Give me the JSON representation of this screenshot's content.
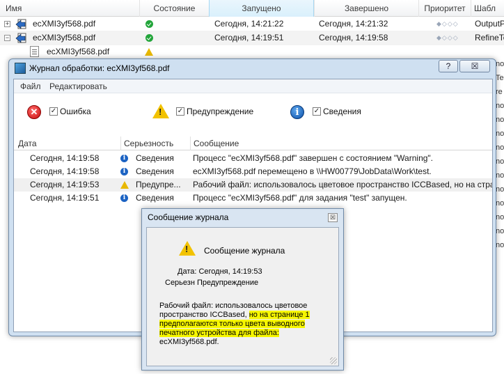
{
  "job_list": {
    "columns": [
      "Имя",
      "Состояние",
      "Запущено",
      "Завершено",
      "Приоритет",
      "Шабл"
    ],
    "rows": [
      {
        "name": "ecXMI3yf568.pdf",
        "started": "Сегодня, 14:21:22",
        "finished": "Сегодня, 14:21:32",
        "priority_dots": "◆◇◇◇",
        "template": "OutputP",
        "expander": "+"
      },
      {
        "name": "ecXMI3yf568.pdf",
        "started": "Сегодня, 14:19:51",
        "finished": "Сегодня, 14:19:58",
        "priority_dots": "◆◇◇◇",
        "template": "RefineTo",
        "expander": "−"
      },
      {
        "name": "ecXMI3yf568.pdf"
      }
    ],
    "right_edge_fragments": [
      "no",
      "Te",
      "re",
      "no",
      "no",
      "no",
      "no",
      "no",
      "no",
      "no",
      "no",
      "no",
      "no",
      "no"
    ]
  },
  "log_window": {
    "title": "Журнал обработки:  ecXMI3yf568.pdf",
    "help_button": "?",
    "close_button": "☒",
    "menu": [
      "Файл",
      "Редактировать"
    ],
    "filters": {
      "error": "Ошибка",
      "warning": "Предупреждение",
      "info": "Сведения",
      "check_mark": "✓"
    },
    "columns": [
      "Дата",
      "Серьезность",
      "Сообщение"
    ],
    "rows": [
      {
        "date": "Сегодня, 14:19:58",
        "severity": "Сведения",
        "message": "Процесс \"ecXMI3yf568.pdf\" завершен с состоянием \"Warning\"."
      },
      {
        "date": "Сегодня, 14:19:58",
        "severity": "Сведения",
        "message": "ecXMI3yf568.pdf перемещено в \\\\HW00779\\JobData\\Work\\test."
      },
      {
        "date": "Сегодня, 14:19:53",
        "severity": "Предупре...",
        "message": "Рабочий файл: использовалось цветовое пространство ICCBased, но на стран"
      },
      {
        "date": "Сегодня, 14:19:51",
        "severity": "Сведения",
        "message": "Процесс \"ecXMI3yf568.pdf\" для задания \"test\" запущен."
      }
    ]
  },
  "message_dialog": {
    "title": "Сообщение журнала",
    "close_button": "☒",
    "heading": "Сообщение журнала",
    "date_line": "Дата: Сегодня, 14:19:53",
    "severity_line": "Серьезн Предупреждение",
    "body_plain_1": "Рабочий файл: использовалось цветовое",
    "body_plain_2": "пространство ICCBased, ",
    "body_marked_1": "но на странице 1",
    "body_marked_2": "предполагаются только цвета выводного",
    "body_marked_3": "печатного устройства для файла:",
    "body_plain_3": "ecXMI3yf568.pdf."
  },
  "colors": {
    "highlight": "#f6f600",
    "ok": "#22a53a",
    "info": "#1c63c3",
    "warning": "#f2c200",
    "error": "#c80b0b"
  }
}
